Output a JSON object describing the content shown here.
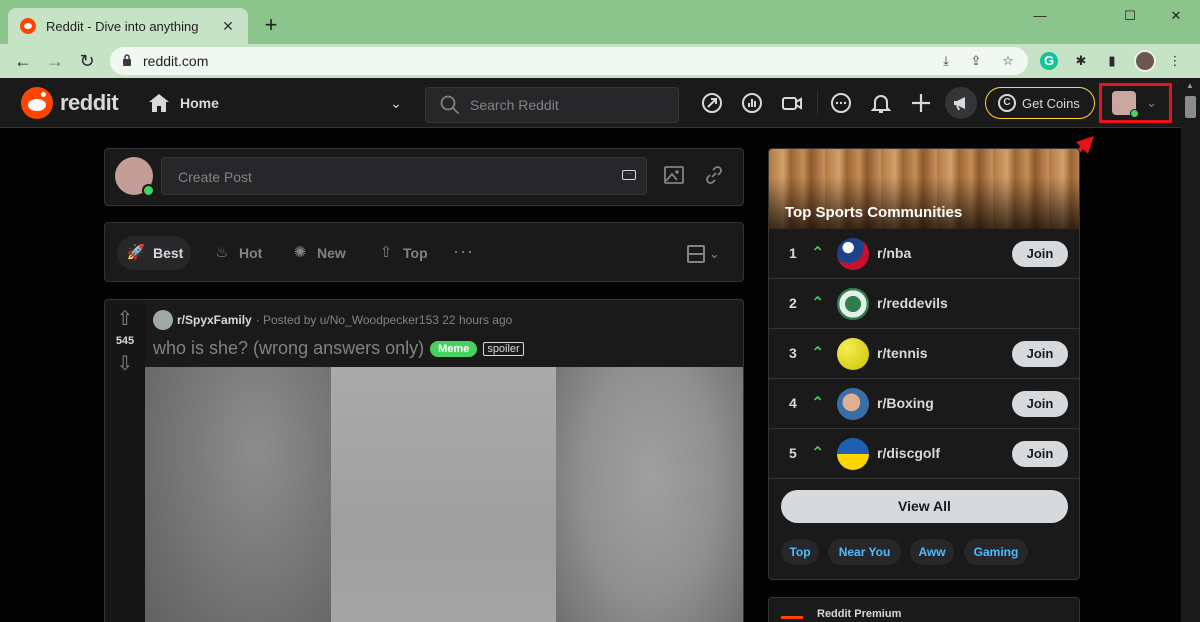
{
  "browser": {
    "tab_title": "Reddit - Dive into anything",
    "tab_close": "✕",
    "new_tab": "+",
    "window_controls": [
      "—",
      "☐",
      "✕"
    ],
    "url": "reddit.com"
  },
  "header": {
    "wordmark": "reddit",
    "home_label": "Home",
    "search_placeholder": "Search Reddit",
    "coins_label": "Get Coins",
    "coin_glyph": "C"
  },
  "create_post": {
    "placeholder": "Create Post"
  },
  "sort": {
    "items": [
      {
        "label": "Best",
        "icon": "rocket-icon",
        "active": true
      },
      {
        "label": "Hot",
        "icon": "flame-icon",
        "active": false
      },
      {
        "label": "New",
        "icon": "sparkle-icon",
        "active": false
      },
      {
        "label": "Top",
        "icon": "top-chart-icon",
        "active": false
      }
    ],
    "more": "···"
  },
  "post": {
    "votes": "545",
    "subreddit": "r/SpyxFamily",
    "posted_by": "· Posted by u/No_Woodpecker153 22 hours ago",
    "title": "who is she? (wrong answers only)",
    "flair": "Meme",
    "spoiler": "spoiler"
  },
  "sidebar": {
    "title": "Top Sports Communities",
    "communities": [
      {
        "rank": "1",
        "name": "r/nba",
        "join": "Join",
        "icon_color": "#1d428a"
      },
      {
        "rank": "2",
        "name": "r/reddevils",
        "join": "",
        "icon_color": "#e6efe9"
      },
      {
        "rank": "3",
        "name": "r/tennis",
        "join": "Join",
        "icon_color": "#e7e02a"
      },
      {
        "rank": "4",
        "name": "r/Boxing",
        "join": "Join",
        "icon_color": "#3a6ea5"
      },
      {
        "rank": "5",
        "name": "r/discgolf",
        "join": "Join",
        "icon_color": "#1e5fb4"
      }
    ],
    "view_all": "View All",
    "chips": [
      "Top",
      "Near You",
      "Aww",
      "Gaming"
    ],
    "premium_label": "Reddit Premium"
  },
  "colors": {
    "accent": "#ff4500",
    "highlight": "#e8131a",
    "online": "#46d160",
    "coins_border": "#ffd635"
  }
}
